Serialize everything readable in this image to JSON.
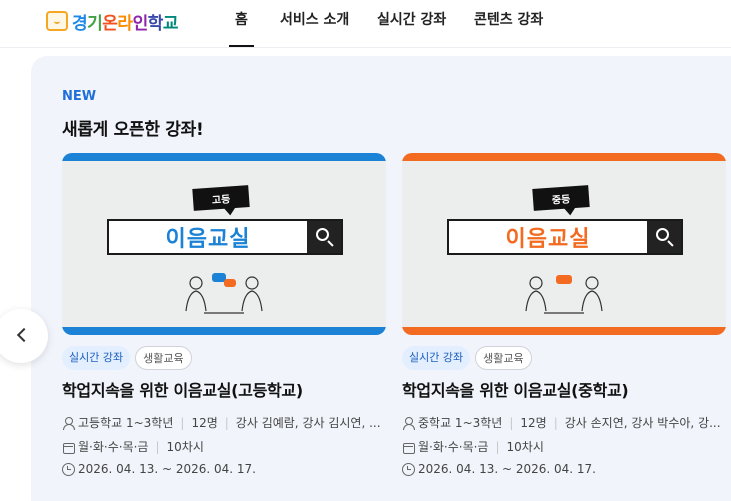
{
  "header": {
    "logo_chars": [
      "경",
      "기",
      "온",
      "라",
      "인",
      "학",
      "교"
    ],
    "nav": [
      {
        "label": "홈",
        "active": true
      },
      {
        "label": "서비스 소개",
        "active": false
      },
      {
        "label": "실시간 강좌",
        "active": false
      },
      {
        "label": "콘텐츠 강좌",
        "active": false
      }
    ]
  },
  "section": {
    "badge": "NEW",
    "title": "새롭게 오픈한 강좌!"
  },
  "cards": [
    {
      "accent": "#1b82d6",
      "thumb": {
        "bubble": "고등",
        "search_text": "이음교실"
      },
      "tags": [
        "실시간 강좌",
        "생활교육"
      ],
      "title": "학업지속을 위한 이음교실(고등학교)",
      "target": "고등학교 1~3학년",
      "count": "12명",
      "instructors": "강사 김예람, 강사 김시연, ...",
      "days": "월·화·수·목·금",
      "sessions": "10차시",
      "period": "2026. 04. 13. ~ 2026. 04. 17."
    },
    {
      "accent": "#f26b21",
      "thumb": {
        "bubble": "중등",
        "search_text": "이음교실"
      },
      "tags": [
        "실시간 강좌",
        "생활교육"
      ],
      "title": "학업지속을 위한 이음교실(중학교)",
      "target": "중학교 1~3학년",
      "count": "12명",
      "instructors": "강사 손지연, 강사 박수아, 강...",
      "days": "월·화·수·목·금",
      "sessions": "10차시",
      "period": "2026. 04. 13. ~ 2026. 04. 17."
    }
  ],
  "icons": {
    "prev": "chevron-left-icon",
    "search": "search-icon",
    "target": "person-icon",
    "days": "calendar-icon",
    "period": "clock-icon"
  }
}
